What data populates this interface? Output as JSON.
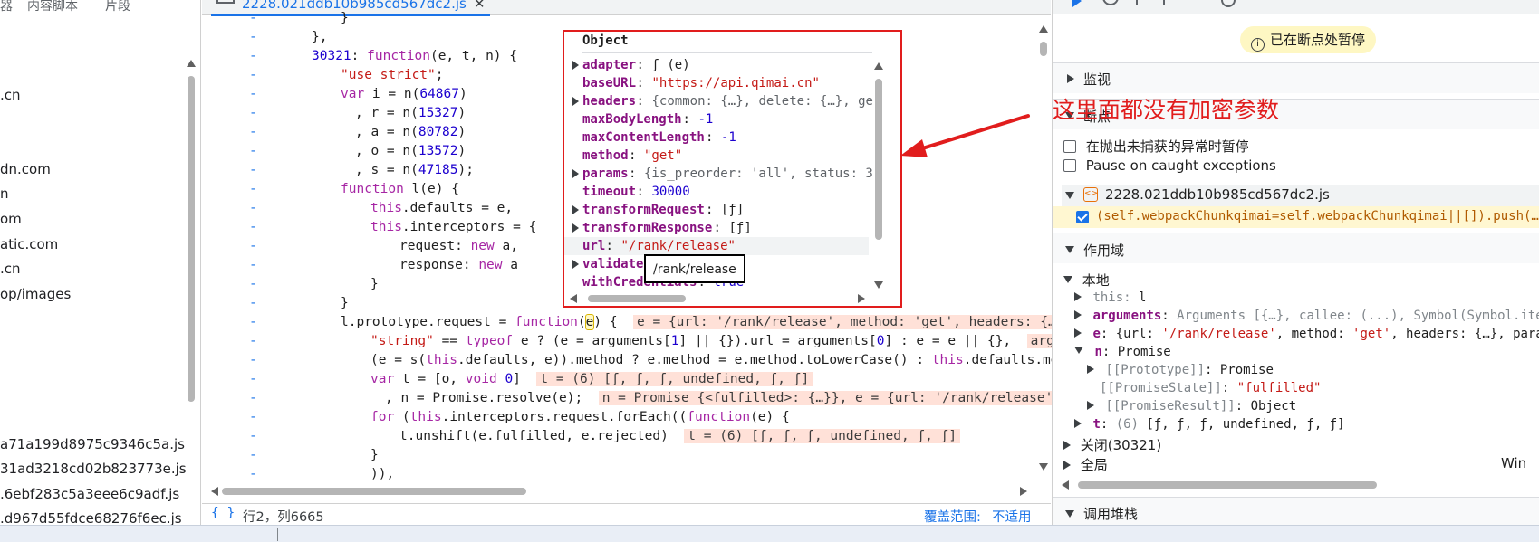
{
  "left_panel": {
    "tabs": [
      "器",
      "内容脚本",
      "片段"
    ],
    "files": [
      ".cn",
      "dn.com",
      "n",
      "om",
      "atic.com",
      ".cn",
      "op/images",
      "a71a199d8975c9346c5a.js",
      "31ad3218cd02b823773e.js",
      ".6ebf283c5a3eee6c9adf.js",
      ".d967d55fdce68276f6ec.js"
    ]
  },
  "editor": {
    "tab_label": "2228.021ddb10b985cd567dc2.js",
    "tab_close": "✕",
    "gutter_mark": "-",
    "status": {
      "braces": "{ }",
      "position": "行2，列6665",
      "coverage_label": "覆盖范围: ",
      "coverage_value": "不适用"
    }
  },
  "popover": {
    "title": "Object",
    "rows": [
      {
        "key": "adapter",
        "value": "ƒ (e)",
        "expandable": true,
        "kind": "fn"
      },
      {
        "key": "baseURL",
        "value": "\"https://api.qimai.cn\"",
        "expandable": false,
        "kind": "str"
      },
      {
        "key": "headers",
        "value": "{common: {…}, delete: {…}, ge",
        "expandable": true,
        "kind": "obj"
      },
      {
        "key": "maxBodyLength",
        "value": "-1",
        "expandable": false,
        "kind": "num"
      },
      {
        "key": "maxContentLength",
        "value": "-1",
        "expandable": false,
        "kind": "num"
      },
      {
        "key": "method",
        "value": "\"get\"",
        "expandable": false,
        "kind": "str"
      },
      {
        "key": "params",
        "value": "{is_preorder: 'all', status: 3",
        "expandable": true,
        "kind": "obj"
      },
      {
        "key": "timeout",
        "value": "30000",
        "expandable": false,
        "kind": "num"
      },
      {
        "key": "transformRequest",
        "value": "[ƒ]",
        "expandable": true,
        "kind": "arr"
      },
      {
        "key": "transformResponse",
        "value": "[ƒ]",
        "expandable": true,
        "kind": "arr"
      },
      {
        "key": "url",
        "value": "\"/rank/release\"",
        "expandable": false,
        "kind": "str"
      },
      {
        "key": "validate",
        "value": "",
        "expandable": true,
        "kind": "obj"
      },
      {
        "key": "withCredentials",
        "value": "true",
        "expandable": false,
        "kind": "num"
      }
    ],
    "tooltip": "/rank/release"
  },
  "annotation": {
    "text": "这里面都没有加密参数",
    "color": "#e11d1d"
  },
  "right_panel": {
    "paused_badge": "已在断点处暂停",
    "watch": "监视",
    "breakpoints": "断点",
    "pause_uncaught": "在抛出未捕获的异常时暂停",
    "pause_caught": "Pause on caught exceptions",
    "bp_file": "2228.021ddb10b985cd567dc2.js",
    "bp_code": "(self.webpackChunkqimai=self.webpackChunkqimai||[]).push(…",
    "scope": "作用域",
    "local": "本地",
    "scope_rows": {
      "this": {
        "key": "this",
        "value": "l"
      },
      "arguments": {
        "key": "arguments",
        "value": "Arguments [{…}, callee: (...), Symbol(Symbol.itera"
      },
      "e": {
        "key": "e",
        "value_pre": "{url: ",
        "value_str": "'/rank/release'",
        "value_mid": ", method: ",
        "value_str2": "'get'",
        "value_post": ", headers: {…}, params"
      },
      "n": {
        "key": "n",
        "value": "Promise"
      },
      "proto": {
        "key": "[[Prototype]]",
        "value": "Promise"
      },
      "state": {
        "key": "[[PromiseState]]",
        "value": "\"fulfilled\""
      },
      "result": {
        "key": "[[PromiseResult]]",
        "value": "Object"
      },
      "t": {
        "key": "t",
        "value_dim": "(6) ",
        "value": "[ƒ, ƒ, ƒ, undefined, ƒ, ƒ]"
      }
    },
    "closure": "关闭(30321)",
    "global": "全局",
    "global_value": "Win",
    "call_stack": "调用堆栈"
  }
}
